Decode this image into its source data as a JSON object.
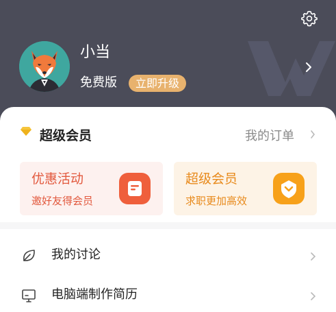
{
  "profile": {
    "username": "小当",
    "edition": "免费版",
    "upgrade_label": "立即升级"
  },
  "vip": {
    "title": "超级会员",
    "orders_label": "我的订单"
  },
  "promos": [
    {
      "title": "优惠活动",
      "subtitle": "邀好友得会员",
      "icon": "coupon-icon",
      "color": "#ef5f3c"
    },
    {
      "title": "超级会员",
      "subtitle": "求职更加高效",
      "icon": "heart-shield-icon",
      "color": "#f7a11a"
    }
  ],
  "menu": [
    {
      "label": "我的讨论",
      "icon": "leaf-icon"
    },
    {
      "label": "电脑端制作简历",
      "icon": "monitor-icon"
    }
  ],
  "colors": {
    "header_bg": "#4b4c59",
    "upgrade_bg": "#e8b26e",
    "avatar_bg": "#3fa79f"
  }
}
